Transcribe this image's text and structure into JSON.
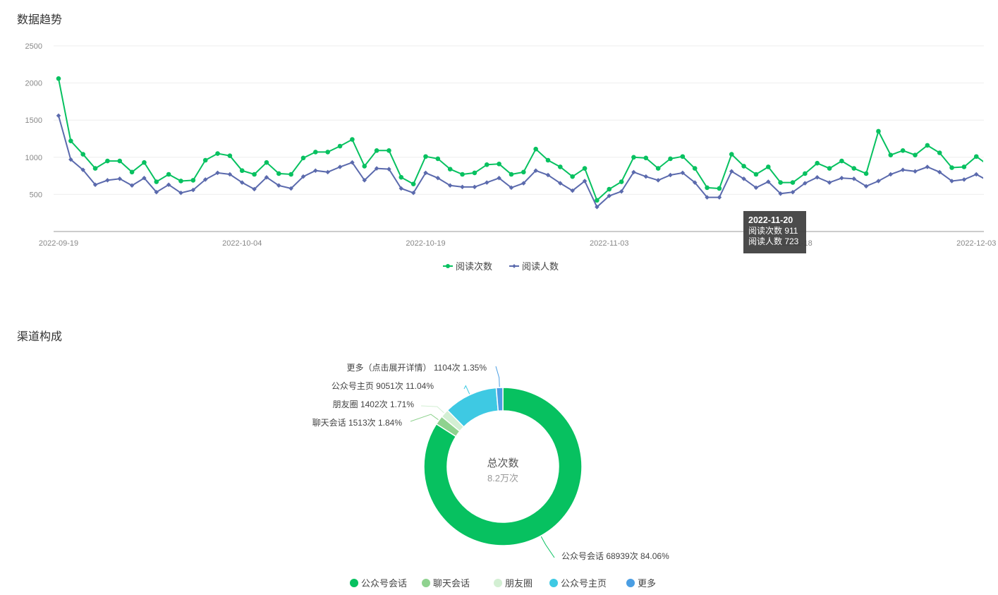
{
  "sections": {
    "trend_title": "数据趋势",
    "channel_title": "渠道构成"
  },
  "tooltip": {
    "date": "2022-11-20",
    "line1": "阅读次数 911",
    "line2": "阅读人数 723"
  },
  "chart_data": [
    {
      "type": "line",
      "x_start": "2022-09-19",
      "x_tick_labels": [
        "2022-09-19",
        "2022-10-04",
        "2022-10-19",
        "2022-11-03",
        "2022-11-18",
        "2022-12-03"
      ],
      "y_ticks": [
        500,
        1000,
        1500,
        2000,
        2500
      ],
      "ylim": [
        0,
        2500
      ],
      "grid": true,
      "legend_position": "bottom",
      "colors": [
        "#07c160",
        "#5b6aad"
      ],
      "series": [
        {
          "name": "阅读次数",
          "values": [
            2060,
            1220,
            1040,
            850,
            950,
            950,
            800,
            930,
            670,
            770,
            680,
            690,
            960,
            1050,
            1020,
            820,
            770,
            930,
            780,
            770,
            990,
            1070,
            1070,
            1150,
            1240,
            880,
            1090,
            1090,
            730,
            640,
            1010,
            980,
            840,
            770,
            790,
            900,
            910,
            770,
            800,
            1110,
            960,
            870,
            740,
            850,
            420,
            570,
            670,
            1000,
            990,
            850,
            980,
            1010,
            850,
            590,
            580,
            1040,
            880,
            770,
            870,
            660,
            660,
            780,
            920,
            850,
            950,
            850,
            780,
            1350,
            1030,
            1090,
            1030,
            1160,
            1060,
            860,
            870,
            1010,
            890
          ],
          "marker": "circle"
        },
        {
          "name": "阅读人数",
          "values": [
            1560,
            970,
            830,
            630,
            690,
            710,
            620,
            720,
            530,
            630,
            520,
            560,
            700,
            790,
            770,
            660,
            570,
            730,
            620,
            580,
            740,
            820,
            800,
            870,
            930,
            690,
            850,
            840,
            580,
            520,
            790,
            720,
            620,
            600,
            600,
            660,
            720,
            590,
            650,
            820,
            760,
            650,
            550,
            680,
            330,
            480,
            540,
            800,
            740,
            690,
            760,
            790,
            660,
            460,
            460,
            810,
            710,
            590,
            670,
            510,
            530,
            650,
            730,
            660,
            720,
            710,
            610,
            680,
            770,
            830,
            810,
            870,
            800,
            680,
            700,
            770,
            680
          ],
          "marker": "diamond"
        }
      ]
    },
    {
      "type": "pie",
      "donut": true,
      "center_title": "总次数",
      "center_value": "8.2万次",
      "legend_position": "bottom",
      "slices": [
        {
          "name": "公众号会话",
          "value": 68939,
          "percent": 84.06,
          "label": "公众号会话 68939次 84.06%",
          "color": "#07c160"
        },
        {
          "name": "聊天会话",
          "value": 1513,
          "percent": 1.84,
          "label": "聊天会话 1513次 1.84%",
          "color": "#8fd28f"
        },
        {
          "name": "朋友圈",
          "value": 1402,
          "percent": 1.71,
          "label": "朋友圈 1402次 1.71%",
          "color": "#d3efd3"
        },
        {
          "name": "公众号主页",
          "value": 9051,
          "percent": 11.04,
          "label": "公众号主页 9051次 11.04%",
          "color": "#3ec9e3"
        },
        {
          "name": "更多",
          "value": 1104,
          "percent": 1.35,
          "label": "更多（点击展开详情） 1104次 1.35%",
          "color": "#4a9ee3"
        }
      ]
    }
  ]
}
